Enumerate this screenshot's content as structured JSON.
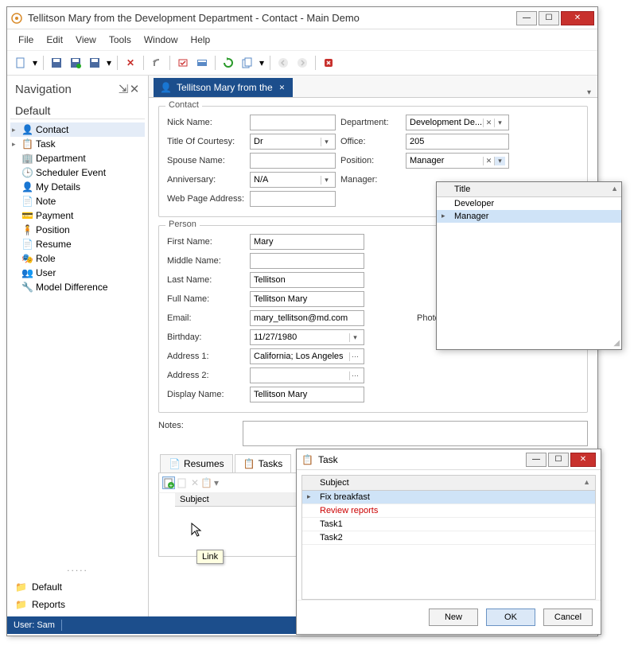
{
  "window": {
    "title": "Tellitson Mary from the Development Department - Contact - Main Demo"
  },
  "menu": {
    "file": "File",
    "edit": "Edit",
    "view": "View",
    "tools": "Tools",
    "window": "Window",
    "help": "Help"
  },
  "nav": {
    "title": "Navigation",
    "default_label": "Default",
    "items": [
      {
        "label": "Contact"
      },
      {
        "label": "Task"
      },
      {
        "label": "Department"
      },
      {
        "label": "Scheduler Event"
      },
      {
        "label": "My Details"
      },
      {
        "label": "Note"
      },
      {
        "label": "Payment"
      },
      {
        "label": "Position"
      },
      {
        "label": "Resume"
      },
      {
        "label": "Role"
      },
      {
        "label": "User"
      },
      {
        "label": "Model Difference"
      }
    ],
    "folders": {
      "default": "Default",
      "reports": "Reports"
    }
  },
  "tab": {
    "label": "Tellitson Mary from the"
  },
  "contact_group": {
    "title": "Contact",
    "nickname_lbl": "Nick Name:",
    "nickname_val": "",
    "title_courtesy_lbl": "Title Of Courtesy:",
    "title_courtesy_val": "Dr",
    "spouse_lbl": "Spouse Name:",
    "spouse_val": "",
    "anniversary_lbl": "Anniversary:",
    "anniversary_val": "N/A",
    "webpage_lbl": "Web Page Address:",
    "webpage_val": "",
    "department_lbl": "Department:",
    "department_val": "Development De...",
    "office_lbl": "Office:",
    "office_val": "205",
    "position_lbl": "Position:",
    "position_val": "Manager",
    "manager_lbl": "Manager:"
  },
  "person_group": {
    "title": "Person",
    "first_lbl": "First Name:",
    "first_val": "Mary",
    "middle_lbl": "Middle Name:",
    "middle_val": "",
    "last_lbl": "Last Name:",
    "last_val": "Tellitson",
    "full_lbl": "Full Name:",
    "full_val": "Tellitson Mary",
    "email_lbl": "Email:",
    "email_val": "mary_tellitson@md.com",
    "birthday_lbl": "Birthday:",
    "birthday_val": "11/27/1980",
    "addr1_lbl": "Address 1:",
    "addr1_val": "California; Los Angeles",
    "addr2_lbl": "Address 2:",
    "addr2_val": "",
    "display_lbl": "Display Name:",
    "display_val": "Tellitson Mary",
    "photo_lbl": "Photo:"
  },
  "notes_lbl": "Notes:",
  "subtabs": {
    "resumes": "Resumes",
    "tasks": "Tasks"
  },
  "subgrid_header": "Subject",
  "position_dropdown": {
    "header": "Title",
    "items": [
      "Developer",
      "Manager"
    ],
    "selected_index": 1
  },
  "task_window": {
    "title": "Task",
    "header": "Subject",
    "rows": [
      {
        "label": "Fix breakfast",
        "sel": true,
        "red": false
      },
      {
        "label": "Review reports",
        "sel": false,
        "red": true
      },
      {
        "label": "Task1",
        "sel": false,
        "red": false
      },
      {
        "label": "Task2",
        "sel": false,
        "red": false
      }
    ],
    "new_btn": "New",
    "ok_btn": "OK",
    "cancel_btn": "Cancel"
  },
  "tooltip": "Link",
  "status": {
    "user": "User: Sam"
  }
}
